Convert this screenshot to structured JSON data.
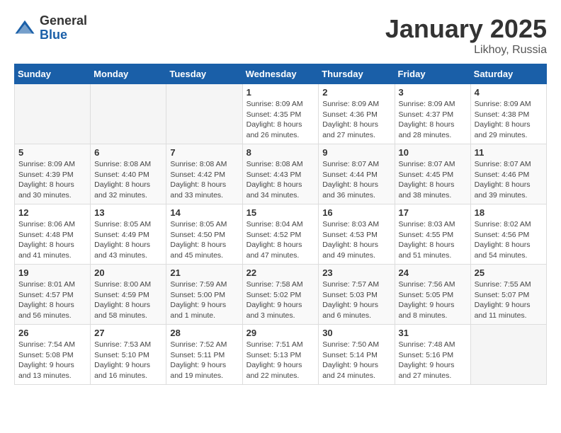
{
  "logo": {
    "general": "General",
    "blue": "Blue"
  },
  "title": {
    "month": "January 2025",
    "location": "Likhoy, Russia"
  },
  "weekdays": [
    "Sunday",
    "Monday",
    "Tuesday",
    "Wednesday",
    "Thursday",
    "Friday",
    "Saturday"
  ],
  "weeks": [
    [
      {
        "day": "",
        "info": ""
      },
      {
        "day": "",
        "info": ""
      },
      {
        "day": "",
        "info": ""
      },
      {
        "day": "1",
        "info": "Sunrise: 8:09 AM\nSunset: 4:35 PM\nDaylight: 8 hours and 26 minutes."
      },
      {
        "day": "2",
        "info": "Sunrise: 8:09 AM\nSunset: 4:36 PM\nDaylight: 8 hours and 27 minutes."
      },
      {
        "day": "3",
        "info": "Sunrise: 8:09 AM\nSunset: 4:37 PM\nDaylight: 8 hours and 28 minutes."
      },
      {
        "day": "4",
        "info": "Sunrise: 8:09 AM\nSunset: 4:38 PM\nDaylight: 8 hours and 29 minutes."
      }
    ],
    [
      {
        "day": "5",
        "info": "Sunrise: 8:09 AM\nSunset: 4:39 PM\nDaylight: 8 hours and 30 minutes."
      },
      {
        "day": "6",
        "info": "Sunrise: 8:08 AM\nSunset: 4:40 PM\nDaylight: 8 hours and 32 minutes."
      },
      {
        "day": "7",
        "info": "Sunrise: 8:08 AM\nSunset: 4:42 PM\nDaylight: 8 hours and 33 minutes."
      },
      {
        "day": "8",
        "info": "Sunrise: 8:08 AM\nSunset: 4:43 PM\nDaylight: 8 hours and 34 minutes."
      },
      {
        "day": "9",
        "info": "Sunrise: 8:07 AM\nSunset: 4:44 PM\nDaylight: 8 hours and 36 minutes."
      },
      {
        "day": "10",
        "info": "Sunrise: 8:07 AM\nSunset: 4:45 PM\nDaylight: 8 hours and 38 minutes."
      },
      {
        "day": "11",
        "info": "Sunrise: 8:07 AM\nSunset: 4:46 PM\nDaylight: 8 hours and 39 minutes."
      }
    ],
    [
      {
        "day": "12",
        "info": "Sunrise: 8:06 AM\nSunset: 4:48 PM\nDaylight: 8 hours and 41 minutes."
      },
      {
        "day": "13",
        "info": "Sunrise: 8:05 AM\nSunset: 4:49 PM\nDaylight: 8 hours and 43 minutes."
      },
      {
        "day": "14",
        "info": "Sunrise: 8:05 AM\nSunset: 4:50 PM\nDaylight: 8 hours and 45 minutes."
      },
      {
        "day": "15",
        "info": "Sunrise: 8:04 AM\nSunset: 4:52 PM\nDaylight: 8 hours and 47 minutes."
      },
      {
        "day": "16",
        "info": "Sunrise: 8:03 AM\nSunset: 4:53 PM\nDaylight: 8 hours and 49 minutes."
      },
      {
        "day": "17",
        "info": "Sunrise: 8:03 AM\nSunset: 4:55 PM\nDaylight: 8 hours and 51 minutes."
      },
      {
        "day": "18",
        "info": "Sunrise: 8:02 AM\nSunset: 4:56 PM\nDaylight: 8 hours and 54 minutes."
      }
    ],
    [
      {
        "day": "19",
        "info": "Sunrise: 8:01 AM\nSunset: 4:57 PM\nDaylight: 8 hours and 56 minutes."
      },
      {
        "day": "20",
        "info": "Sunrise: 8:00 AM\nSunset: 4:59 PM\nDaylight: 8 hours and 58 minutes."
      },
      {
        "day": "21",
        "info": "Sunrise: 7:59 AM\nSunset: 5:00 PM\nDaylight: 9 hours and 1 minute."
      },
      {
        "day": "22",
        "info": "Sunrise: 7:58 AM\nSunset: 5:02 PM\nDaylight: 9 hours and 3 minutes."
      },
      {
        "day": "23",
        "info": "Sunrise: 7:57 AM\nSunset: 5:03 PM\nDaylight: 9 hours and 6 minutes."
      },
      {
        "day": "24",
        "info": "Sunrise: 7:56 AM\nSunset: 5:05 PM\nDaylight: 9 hours and 8 minutes."
      },
      {
        "day": "25",
        "info": "Sunrise: 7:55 AM\nSunset: 5:07 PM\nDaylight: 9 hours and 11 minutes."
      }
    ],
    [
      {
        "day": "26",
        "info": "Sunrise: 7:54 AM\nSunset: 5:08 PM\nDaylight: 9 hours and 13 minutes."
      },
      {
        "day": "27",
        "info": "Sunrise: 7:53 AM\nSunset: 5:10 PM\nDaylight: 9 hours and 16 minutes."
      },
      {
        "day": "28",
        "info": "Sunrise: 7:52 AM\nSunset: 5:11 PM\nDaylight: 9 hours and 19 minutes."
      },
      {
        "day": "29",
        "info": "Sunrise: 7:51 AM\nSunset: 5:13 PM\nDaylight: 9 hours and 22 minutes."
      },
      {
        "day": "30",
        "info": "Sunrise: 7:50 AM\nSunset: 5:14 PM\nDaylight: 9 hours and 24 minutes."
      },
      {
        "day": "31",
        "info": "Sunrise: 7:48 AM\nSunset: 5:16 PM\nDaylight: 9 hours and 27 minutes."
      },
      {
        "day": "",
        "info": ""
      }
    ]
  ]
}
